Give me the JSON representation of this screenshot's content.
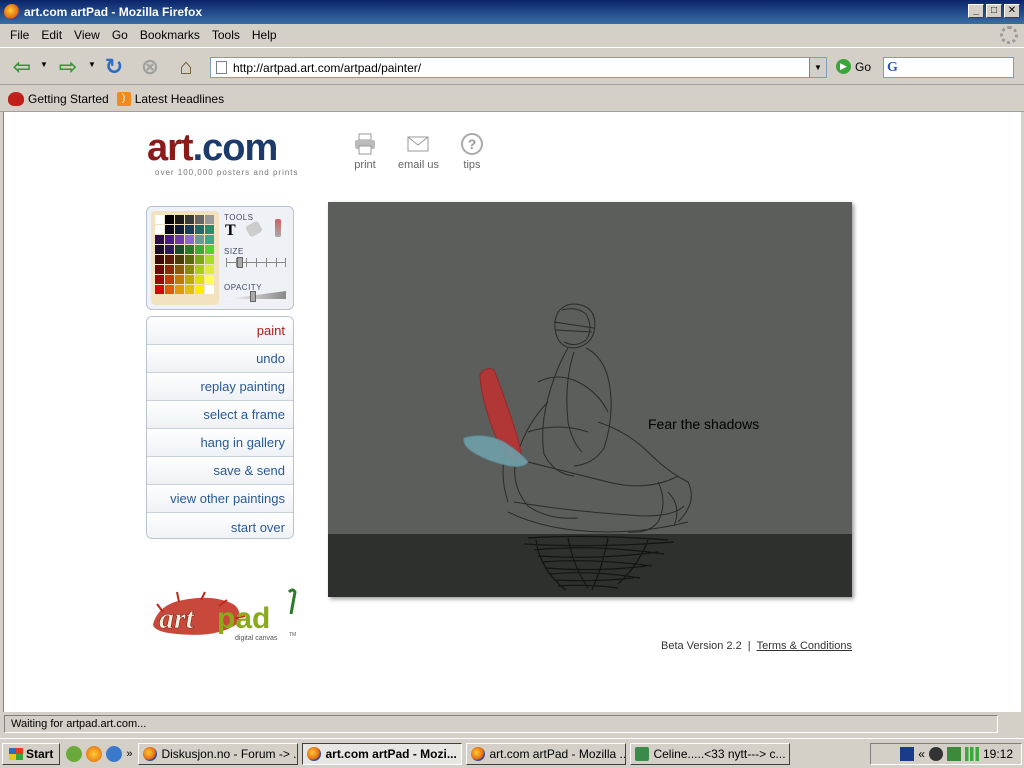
{
  "window": {
    "title": "art.com artPad - Mozilla Firefox"
  },
  "menu": {
    "items": [
      {
        "label": "File",
        "key": "F"
      },
      {
        "label": "Edit",
        "key": "E"
      },
      {
        "label": "View",
        "key": "V"
      },
      {
        "label": "Go",
        "key": "G"
      },
      {
        "label": "Bookmarks",
        "key": "B"
      },
      {
        "label": "Tools",
        "key": "T"
      },
      {
        "label": "Help",
        "key": "H"
      }
    ]
  },
  "nav": {
    "url": "http://artpad.art.com/artpad/painter/",
    "go_label": "Go"
  },
  "bookmarks": [
    {
      "label": "Getting Started",
      "icon": "getting-started-icon"
    },
    {
      "label": "Latest Headlines",
      "icon": "rss-feed-icon"
    }
  ],
  "site": {
    "logo_art": "art",
    "logo_dot": ".",
    "logo_com": "com",
    "logo_tagline": "over 100,000 posters and prints",
    "top_icons": [
      {
        "label": "print",
        "icon": "printer-icon"
      },
      {
        "label": "email us",
        "icon": "envelope-icon"
      },
      {
        "label": "tips",
        "icon": "question-icon"
      }
    ]
  },
  "palette": {
    "tools_label": "TOOLS",
    "size_label": "SIZE",
    "opacity_label": "OPACITY",
    "size_level": 0.2,
    "opacity_level": 0.45,
    "colors": [
      "#ffffff",
      "#000000",
      "#1a1a1a",
      "#3a3a3a",
      "#666666",
      "#999999",
      "#ffffff",
      "#05051a",
      "#0d1a3a",
      "#1a3a5a",
      "#206a6a",
      "#2a8a6a",
      "#2a0a4a",
      "#4a1a8a",
      "#6a3aaa",
      "#8a6acc",
      "#6a9a9a",
      "#3aaa8a",
      "#1a0a2a",
      "#2a1a5a",
      "#1a4a2a",
      "#2a7a2a",
      "#3aaa3a",
      "#5acc3a",
      "#3a0a0a",
      "#5a1a0a",
      "#4a3a0a",
      "#5a6a0a",
      "#7aaa1a",
      "#aadd2a",
      "#6a0a0a",
      "#8a2a0a",
      "#8a5a0a",
      "#8a8a0a",
      "#aacc1a",
      "#ddee3a",
      "#9a0a0a",
      "#c03a0a",
      "#c07a0a",
      "#c0aa0a",
      "#dddd1a",
      "#ffff5a",
      "#d00a0a",
      "#e05a0a",
      "#e09a0a",
      "#e0c00a",
      "#ffee00",
      "#ffffff"
    ]
  },
  "side_menu": [
    {
      "label": "paint",
      "active": true
    },
    {
      "label": "undo",
      "active": false
    },
    {
      "label": "replay painting",
      "active": false
    },
    {
      "label": "select a frame",
      "active": false
    },
    {
      "label": "hang in gallery",
      "active": false
    },
    {
      "label": "save & send",
      "active": false
    },
    {
      "label": "view other paintings",
      "active": false
    },
    {
      "label": "start over",
      "active": false
    }
  ],
  "canvas": {
    "caption": "Fear the shadows",
    "bg_color": "#5b5e5a",
    "ground_color": "#2e302d"
  },
  "artpad_logo": {
    "text": "artpad",
    "sub": "digital canvas",
    "tm": "TM"
  },
  "footer": {
    "version": "Beta Version 2.2",
    "separator": "|",
    "terms": "Terms & Conditions"
  },
  "status": {
    "text": "Waiting for artpad.art.com..."
  },
  "taskbar": {
    "start": "Start",
    "overflow": "»",
    "tasks": [
      {
        "label": "Diskusjon.no - Forum -> ...",
        "active": false
      },
      {
        "label": "art.com artPad - Mozi...",
        "active": true
      },
      {
        "label": "art.com artPad - Mozilla ...",
        "active": false
      },
      {
        "label": "Celine.....<33 nytt---> c...",
        "active": false
      }
    ],
    "tray_prefix": "«",
    "clock": "19:12"
  }
}
